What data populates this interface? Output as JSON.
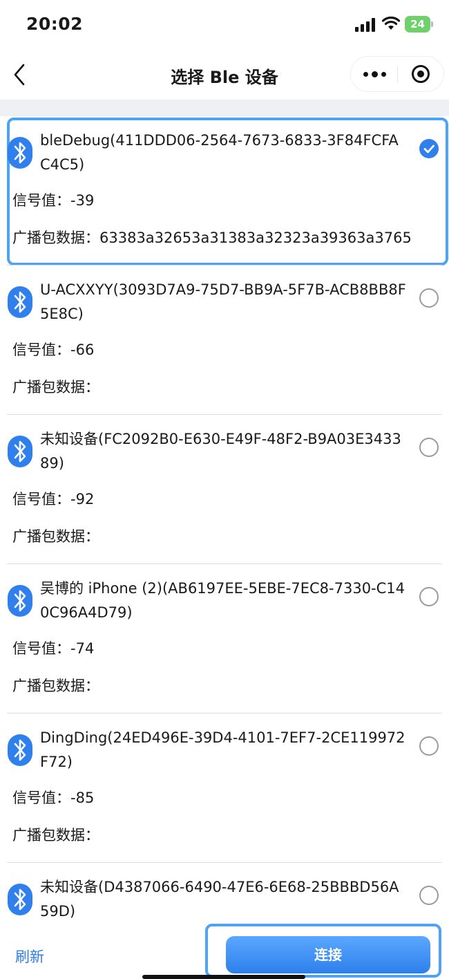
{
  "status_bar": {
    "time": "20:02",
    "battery": "24"
  },
  "nav": {
    "title": "选择 Ble 设备"
  },
  "devices": [
    {
      "name": "bleDebug(411DDD06-2564-7673-6833-3F84FCFAC4C5)",
      "rssi": "信号值：-39",
      "adv": "广播包数据：63383a32653a31383a32323a39363a3765",
      "selected": true
    },
    {
      "name": "U-ACXXYY(3093D7A9-75D7-BB9A-5F7B-ACB8BB8F5E8C)",
      "rssi": "信号值：-66",
      "adv": "广播包数据：",
      "selected": false
    },
    {
      "name": "未知设备(FC2092B0-E630-E49F-48F2-B9A03E343389)",
      "rssi": "信号值：-92",
      "adv": "广播包数据：",
      "selected": false
    },
    {
      "name": "吴博的 iPhone (2)(AB6197EE-5EBE-7EC8-7330-C140C96A4D79)",
      "rssi": "信号值：-74",
      "adv": "广播包数据：",
      "selected": false
    },
    {
      "name": "DingDing(24ED496E-39D4-4101-7EF7-2CE119972F72)",
      "rssi": "信号值：-85",
      "adv": "广播包数据：",
      "selected": false
    },
    {
      "name": "未知设备(D4387066-6490-47E6-6E68-25BBBD56A59D)",
      "rssi": "",
      "adv": "",
      "selected": false
    }
  ],
  "footer": {
    "refresh_label": "刷新",
    "connect_label": "连接"
  },
  "colors": {
    "accent": "#2f80ed",
    "selection_border": "#4ea3f4",
    "battery": "#6fd16b"
  },
  "icons": [
    "signal-icon",
    "wifi-icon",
    "battery-icon",
    "back-arrow-icon",
    "more-dots-icon",
    "close-miniprogram-icon",
    "bluetooth-icon",
    "check-icon"
  ]
}
